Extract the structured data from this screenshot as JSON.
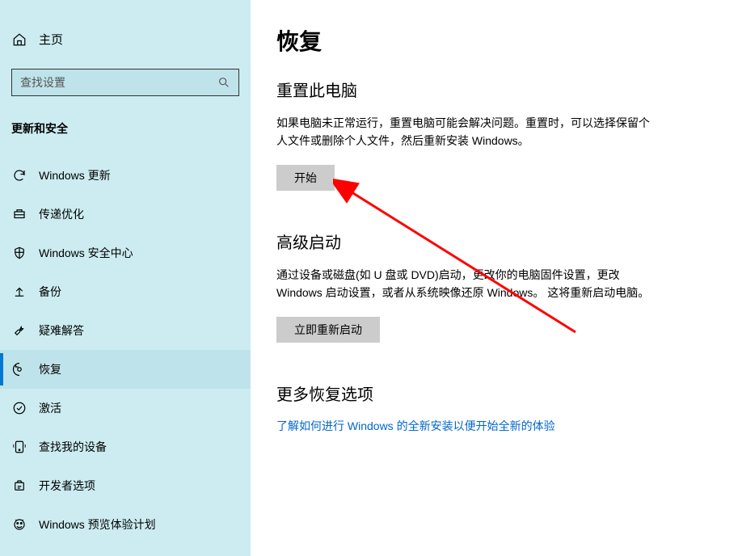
{
  "sidebar": {
    "home_label": "主页",
    "search_placeholder": "查找设置",
    "category_title": "更新和安全",
    "items": [
      {
        "label": "Windows 更新",
        "icon": "sync"
      },
      {
        "label": "传递优化",
        "icon": "delivery"
      },
      {
        "label": "Windows 安全中心",
        "icon": "shield"
      },
      {
        "label": "备份",
        "icon": "backup"
      },
      {
        "label": "疑难解答",
        "icon": "troubleshoot"
      },
      {
        "label": "恢复",
        "icon": "recovery"
      },
      {
        "label": "激活",
        "icon": "activation"
      },
      {
        "label": "查找我的设备",
        "icon": "findmydevice"
      },
      {
        "label": "开发者选项",
        "icon": "developer"
      },
      {
        "label": "Windows 预览体验计划",
        "icon": "insider"
      }
    ]
  },
  "main": {
    "page_title": "恢复",
    "sections": {
      "reset": {
        "title": "重置此电脑",
        "desc": "如果电脑未正常运行，重置电脑可能会解决问题。重置时，可以选择保留个人文件或删除个人文件，然后重新安装 Windows。",
        "button": "开始"
      },
      "advanced": {
        "title": "高级启动",
        "desc": "通过设备或磁盘(如 U 盘或 DVD)启动，更改你的电脑固件设置，更改 Windows 启动设置，或者从系统映像还原 Windows。 这将重新启动电脑。",
        "button": "立即重新启动"
      },
      "more": {
        "title": "更多恢复选项",
        "link": "了解如何进行 Windows 的全新安装以便开始全新的体验"
      }
    }
  }
}
